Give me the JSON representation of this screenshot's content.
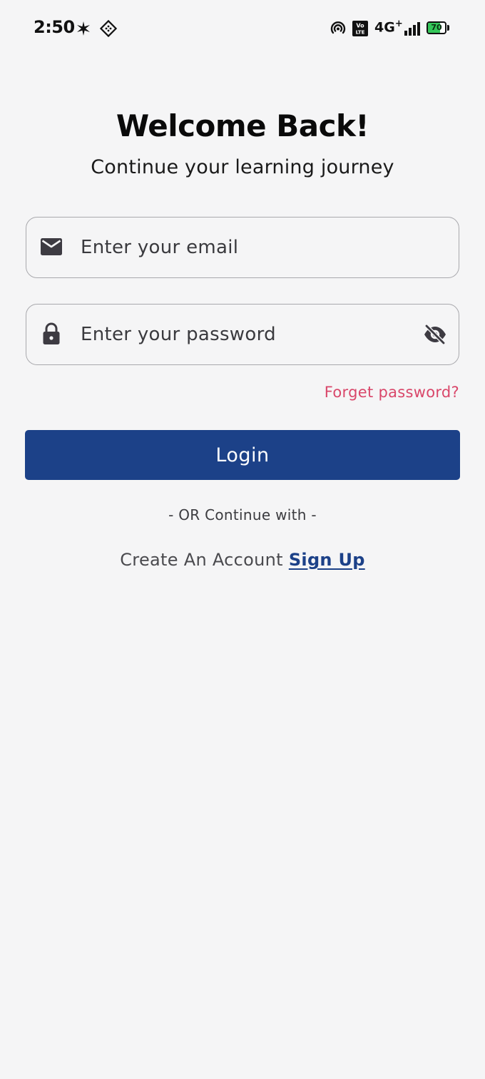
{
  "status_bar": {
    "time": "2:50",
    "network_label": "4G",
    "network_plus": "+",
    "battery_level": "70",
    "battery_fraction": 0.7,
    "battery_color": "#34c759",
    "icons": [
      "sparkle-notification-icon",
      "diamond-app-icon",
      "hotspot-icon",
      "volte-icon",
      "signal-icon",
      "battery-charging-icon"
    ]
  },
  "header": {
    "title": "Welcome Back!",
    "subtitle": "Continue your learning journey"
  },
  "form": {
    "email": {
      "placeholder": "Enter your email",
      "value": "",
      "icon": "mail-icon"
    },
    "password": {
      "placeholder": "Enter your password",
      "value": "",
      "icon": "lock-icon",
      "toggle_icon": "eye-off-icon"
    },
    "forgot_label": "Forget password?",
    "login_label": "Login",
    "or_label": "- OR Continue with -",
    "account_prompt": "Create An Account",
    "signup_label": "Sign Up"
  },
  "colors": {
    "background": "#f5f5f6",
    "primary": "#1c4188",
    "accent_link": "#d9476a",
    "field_border": "#a9a9ad"
  }
}
